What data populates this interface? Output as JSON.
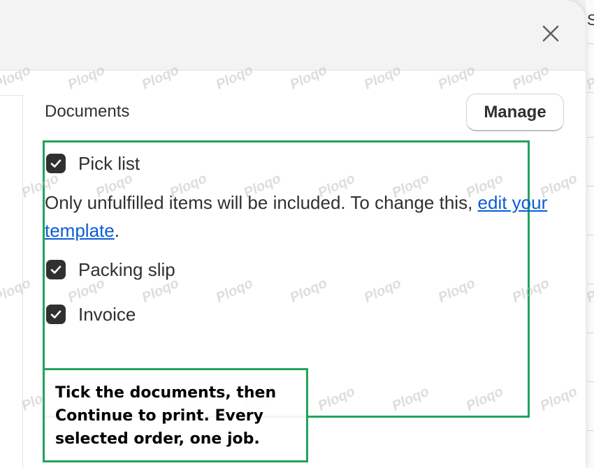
{
  "watermark": "Ploqo",
  "background": {
    "partial_letter": "S"
  },
  "modal": {
    "close_icon": "close-x",
    "documents_title": "Documents",
    "manage_label": "Manage",
    "options": [
      {
        "label": "Pick list",
        "checked": true
      },
      {
        "label": "Packing slip",
        "checked": true
      },
      {
        "label": "Invoice",
        "checked": true
      }
    ],
    "note": {
      "text_before": "Only unfulfilled items will be included. To change this, ",
      "link_text": "edit your template",
      "text_after": "."
    }
  },
  "annotation": {
    "text": "Tick the documents, then Continue to print. Every selected order, one job."
  },
  "colors": {
    "checkbox": "#303030",
    "link": "#0b5cd6",
    "highlight": "#22a35a"
  }
}
